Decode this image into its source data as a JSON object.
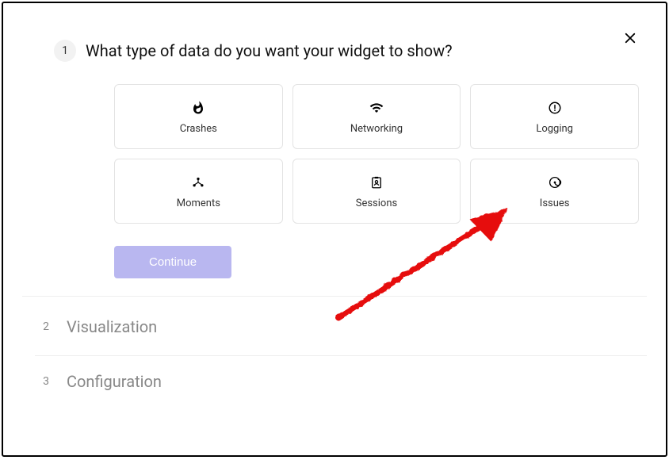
{
  "close_label": "Close",
  "steps": {
    "step1": {
      "number": "1",
      "title": "What type of data do you want your widget to show?"
    },
    "step2": {
      "number": "2",
      "title": "Visualization"
    },
    "step3": {
      "number": "3",
      "title": "Configuration"
    }
  },
  "options": {
    "crashes": {
      "label": "Crashes",
      "icon": "flame-icon"
    },
    "networking": {
      "label": "Networking",
      "icon": "wifi-icon"
    },
    "logging": {
      "label": "Logging",
      "icon": "alert-circle-icon"
    },
    "moments": {
      "label": "Moments",
      "icon": "hub-icon"
    },
    "sessions": {
      "label": "Sessions",
      "icon": "badge-icon"
    },
    "issues": {
      "label": "Issues",
      "icon": "radar-icon"
    }
  },
  "continue_label": "Continue",
  "annotation": {
    "color": "#e61010",
    "description": "Hand-drawn arrow pointing to Issues card"
  }
}
